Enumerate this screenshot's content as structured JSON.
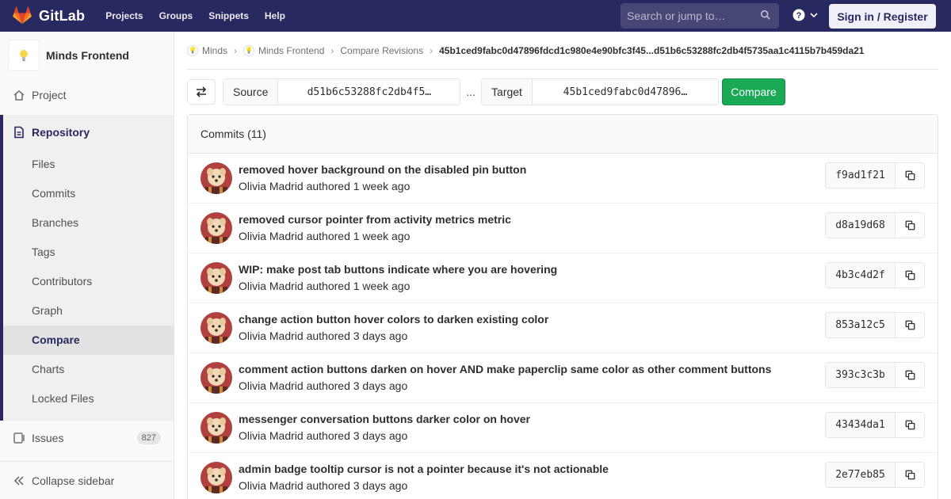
{
  "navbar": {
    "brand": "GitLab",
    "links": [
      "Projects",
      "Groups",
      "Snippets",
      "Help"
    ],
    "search_placeholder": "Search or jump to…",
    "signin": "Sign in / Register"
  },
  "sidebar": {
    "project_name": "Minds Frontend",
    "project_label": "Project",
    "repository_label": "Repository",
    "repo_items": [
      "Files",
      "Commits",
      "Branches",
      "Tags",
      "Contributors",
      "Graph",
      "Compare",
      "Charts",
      "Locked Files"
    ],
    "active_item": "Compare",
    "issues_label": "Issues",
    "issues_count": "827",
    "collapse_label": "Collapse sidebar"
  },
  "breadcrumb": {
    "items": [
      "Minds",
      "Minds Frontend",
      "Compare Revisions"
    ],
    "current": "45b1ced9fabc0d47896fdcd1c980e4e90bfc3f45...d51b6c53288fc2db4f5735aa1c4115b7b459da21"
  },
  "compare": {
    "source_label": "Source",
    "source_value": "d51b6c53288fc2db4f5…",
    "separator": "...",
    "target_label": "Target",
    "target_value": "45b1ced9fabc0d47896…",
    "button": "Compare"
  },
  "commits": {
    "header": "Commits (11)",
    "items": [
      {
        "title": "removed hover background on the disabled pin button",
        "author": "Olivia Madrid",
        "when": "authored 1 week ago",
        "sha": "f9ad1f21"
      },
      {
        "title": "removed cursor pointer from activity metrics metric",
        "author": "Olivia Madrid",
        "when": "authored 1 week ago",
        "sha": "d8a19d68"
      },
      {
        "title": "WIP: make post tab buttons indicate where you are hovering",
        "author": "Olivia Madrid",
        "when": "authored 1 week ago",
        "sha": "4b3c4d2f"
      },
      {
        "title": "change action button hover colors to darken existing color",
        "author": "Olivia Madrid",
        "when": "authored 3 days ago",
        "sha": "853a12c5"
      },
      {
        "title": "comment action buttons darken on hover AND make paperclip same color as other comment buttons",
        "author": "Olivia Madrid",
        "when": "authored 3 days ago",
        "sha": "393c3c3b"
      },
      {
        "title": "messenger conversation buttons darker color on hover",
        "author": "Olivia Madrid",
        "when": "authored 3 days ago",
        "sha": "43434da1"
      },
      {
        "title": "admin badge tooltip cursor is not a pointer because it's not actionable",
        "author": "Olivia Madrid",
        "when": "authored 3 days ago",
        "sha": "2e77eb85"
      }
    ]
  },
  "colors": {
    "navbar": "#292961",
    "compare_button": "#1aaa55",
    "sidebar_accent": "#292961"
  }
}
